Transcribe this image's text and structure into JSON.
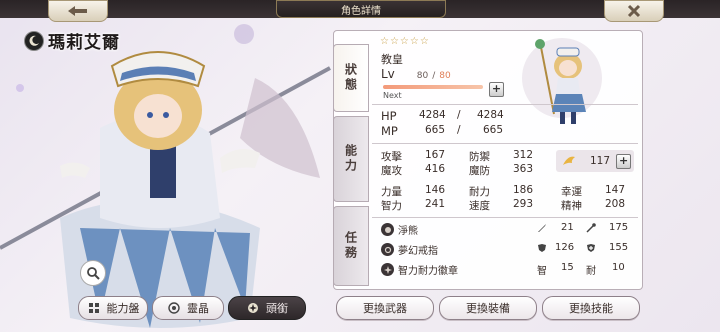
{
  "header": {
    "title": "角色詳情"
  },
  "character": {
    "name": "瑪莉艾爾",
    "element": "dark-moon"
  },
  "status_tabs": {
    "status": "狀態",
    "ability": "能力",
    "duty": "任務"
  },
  "profile": {
    "stars": "☆☆☆☆☆",
    "job": "教皇",
    "lv_label": "Lv",
    "lv_current": "80",
    "lv_sep": "/",
    "lv_max": "80",
    "next_label": "Next",
    "exp_fill_fraction": 1.0
  },
  "vitals": {
    "hp_label": "HP",
    "hp_current": "4284",
    "hp_sep": "/",
    "hp_max": "4284",
    "mp_label": "MP",
    "mp_current": "665",
    "mp_sep": "/",
    "mp_max": "665"
  },
  "combat_stats": [
    {
      "label": "攻擊",
      "value": "167"
    },
    {
      "label": "防禦",
      "value": "312"
    },
    {
      "label": "魔攻",
      "value": "416"
    },
    {
      "label": "魔防",
      "value": "363"
    }
  ],
  "points": {
    "value": "117"
  },
  "attr_stats": [
    {
      "label": "力量",
      "value": "146"
    },
    {
      "label": "耐力",
      "value": "186"
    },
    {
      "label": "幸運",
      "value": "147"
    },
    {
      "label": "智力",
      "value": "241"
    },
    {
      "label": "速度",
      "value": "293"
    },
    {
      "label": "精神",
      "value": "208"
    }
  ],
  "equipment": [
    {
      "name": "淨熊",
      "s1": "21",
      "s2": "175"
    },
    {
      "name": "夢幻戒指",
      "s1": "126",
      "s2": "155"
    },
    {
      "name": "智力耐力徽章",
      "s1_label": "智",
      "s1": "15",
      "s2_label": "耐",
      "s2": "10"
    }
  ],
  "bottom_buttons": {
    "ability_board": "能力盤",
    "spirit": "靈晶",
    "title": "頭銜"
  },
  "action_buttons": {
    "weapon": "更換武器",
    "gear": "更換裝備",
    "skill": "更換技能"
  },
  "colors": {
    "accent": "#f39a7a",
    "panel": "#ffffff",
    "dark": "#2d2729"
  }
}
